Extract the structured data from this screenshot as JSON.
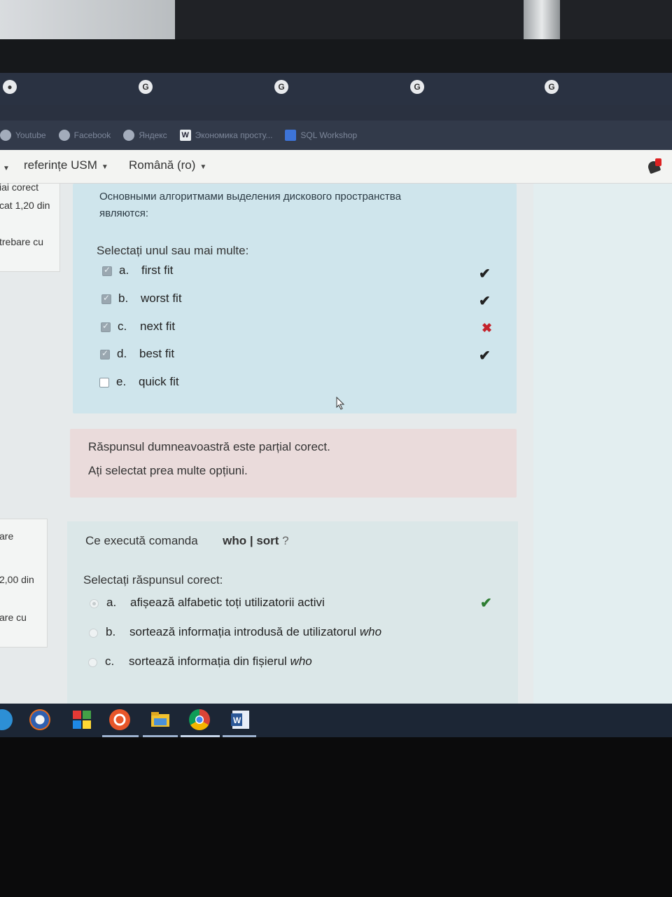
{
  "browser": {
    "url_text": "",
    "bookmarks": [
      {
        "label": "Youtube",
        "icon": "globe-icon"
      },
      {
        "label": "Facebook",
        "icon": "globe-icon"
      },
      {
        "label": "Яндекс",
        "icon": "globe-icon"
      },
      {
        "label": "Экономика просту...",
        "icon": "word-icon"
      },
      {
        "label": "SQL Workshop",
        "icon": "sql-icon"
      }
    ]
  },
  "nav": {
    "references": "referințe USM",
    "language": "Română (ro)"
  },
  "left_info_1": {
    "line1": "iai corect",
    "line2": "cat 1,20 din",
    "line3": "trebare cu"
  },
  "left_info_2": {
    "line1": "are",
    "line2": "2,00 din",
    "line3": "are cu"
  },
  "question1": {
    "text_line1": "Основными алгоритмами выделения дискового пространства",
    "text_line2": "являются:",
    "instruction": "Selectați unul sau mai multe:",
    "options": [
      {
        "letter": "a.",
        "text": "first fit",
        "checked": true,
        "result": "✔"
      },
      {
        "letter": "b.",
        "text": "worst fit",
        "checked": true,
        "result": "✔"
      },
      {
        "letter": "c.",
        "text": "next fit",
        "checked": true,
        "result": "✖"
      },
      {
        "letter": "d.",
        "text": "best fit",
        "checked": true,
        "result": "✔"
      },
      {
        "letter": "e.",
        "text": "quick fit",
        "checked": false,
        "result": ""
      }
    ]
  },
  "feedback": {
    "line1": "Răspunsul dumneavoastră este parțial corect.",
    "line2": "Ați selectat prea multe opțiuni."
  },
  "question2": {
    "text_prefix": "Ce execută comanda",
    "command": "who | sort",
    "text_suffix": "?",
    "instruction": "Selectați răspunsul corect:",
    "options": [
      {
        "letter": "a.",
        "text": "afișează alfabetic toți utilizatorii activi",
        "italic": "",
        "selected": true,
        "result": "✔"
      },
      {
        "letter": "b.",
        "text": "sortează informația introdusă de utilizatorul ",
        "italic": "who",
        "selected": false,
        "result": ""
      },
      {
        "letter": "c.",
        "text": "sortează informația din fișierul ",
        "italic": "who",
        "selected": false,
        "result": ""
      }
    ]
  },
  "colors": {
    "question_bg": "#cfe5ec",
    "feedback_bg": "#eadbdb",
    "correct": "#2e7d32",
    "incorrect": "#c4232b"
  }
}
